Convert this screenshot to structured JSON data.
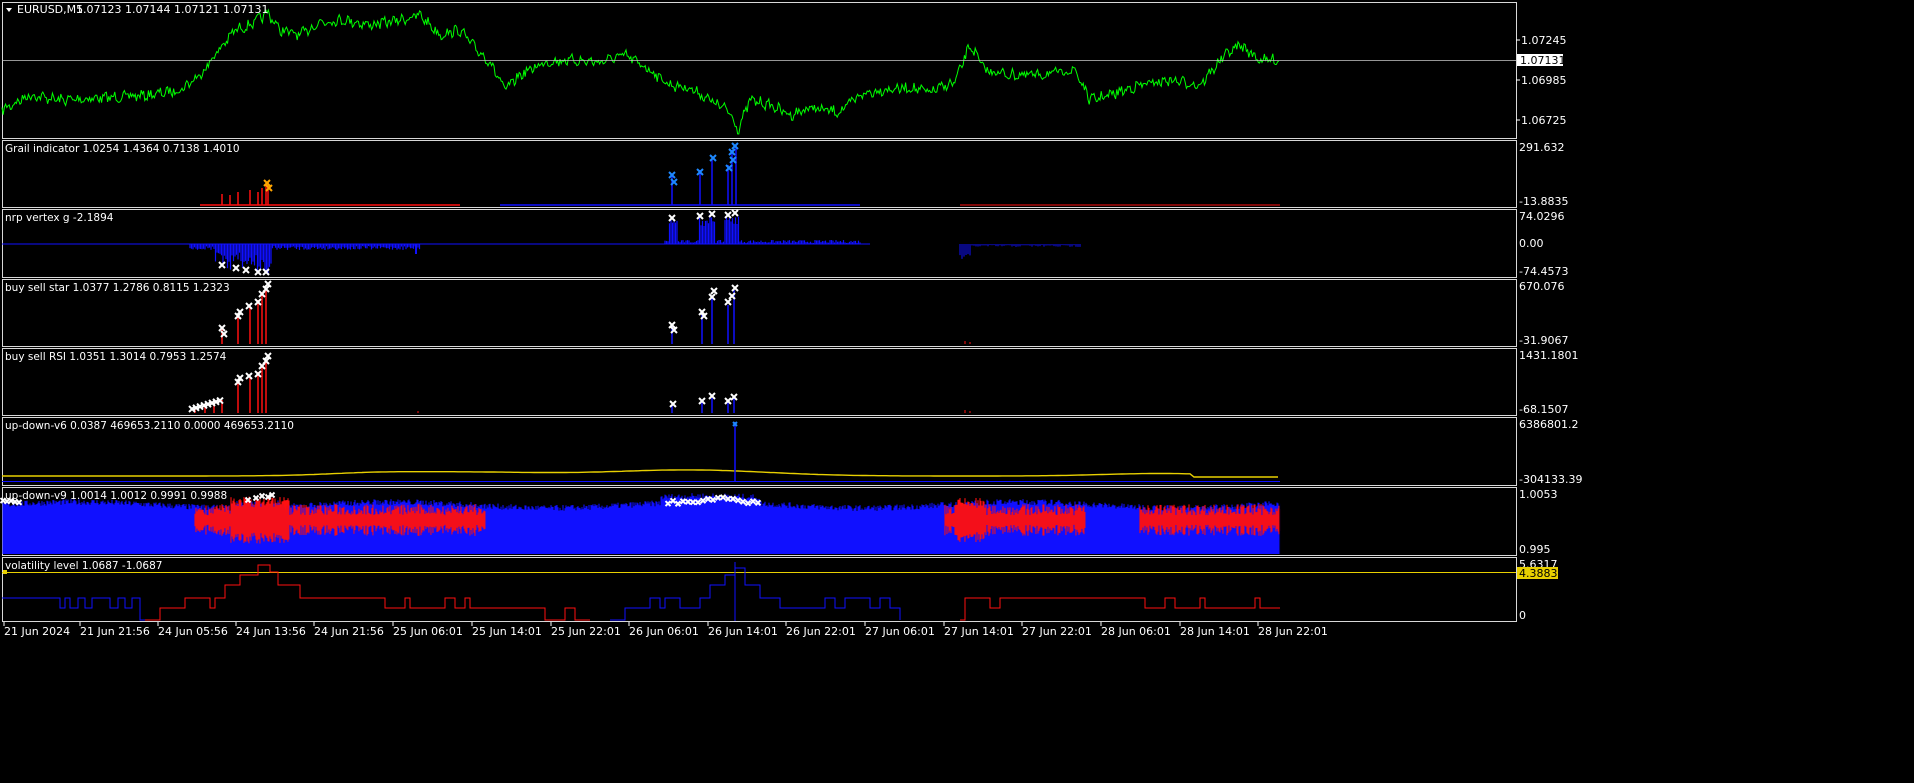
{
  "symbol_header": {
    "collapse_arrow": "triangle-down",
    "symbol": "EURUSD,M5",
    "ohlc": "1.07123 1.07144 1.07121 1.07131"
  },
  "current_price": "1.07131",
  "colors": {
    "background": "#000000",
    "price_line": "#00ff00",
    "blue": "#1010ff",
    "red": "#ff1010",
    "yellow": "#e8d000",
    "white_marker": "#ffffff",
    "grid_frame": "#d8d8d8"
  },
  "main_scale": [
    "1.07245",
    "1.06985",
    "1.06725"
  ],
  "panes": [
    {
      "id": "grail",
      "label": "Grail indicator 1.0254 1.4364 0.7138 1.4010",
      "scale_top": "291.632",
      "scale_mid": "",
      "scale_bottom": "-13.8835"
    },
    {
      "id": "nrp",
      "label": "nrp vertex g -2.1894",
      "scale_top": "74.0296",
      "scale_mid": "0.00",
      "scale_bottom": "-74.4573"
    },
    {
      "id": "bss",
      "label": "buy sell star 1.0377 1.2786 0.8115 1.2323",
      "scale_top": "670.076",
      "scale_mid": "",
      "scale_bottom": "-31.9067"
    },
    {
      "id": "rsi",
      "label": "buy sell RSI 1.0351 1.3014 0.7953 1.2574",
      "scale_top": "1431.1801",
      "scale_mid": "",
      "scale_bottom": "-68.1507"
    },
    {
      "id": "v6",
      "label": "up-down-v6 0.0387 469653.2110 0.0000 469653.2110",
      "scale_top": "6386801.2",
      "scale_mid": "",
      "scale_bottom": "-304133.39"
    },
    {
      "id": "v9",
      "label": "up-down-v9 1.0014 1.0012 0.9991 0.9988",
      "scale_top": "1.0053",
      "scale_mid": "",
      "scale_bottom": "0.995"
    },
    {
      "id": "vol",
      "label": "volatility level 1.0687 -1.0687",
      "scale_top": "5.6317",
      "scale_mid": "0",
      "scale_bottom": ""
    }
  ],
  "volatility_tag": "4.3883",
  "time_axis": [
    "21 Jun 2024",
    "21 Jun 21:56",
    "24 Jun 05:56",
    "24 Jun 13:56",
    "24 Jun 21:56",
    "25 Jun 06:01",
    "25 Jun 14:01",
    "25 Jun 22:01",
    "26 Jun 06:01",
    "26 Jun 14:01",
    "26 Jun 22:01",
    "27 Jun 06:01",
    "27 Jun 14:01",
    "27 Jun 22:01",
    "28 Jun 06:01",
    "28 Jun 14:01",
    "28 Jun 22:01"
  ]
}
